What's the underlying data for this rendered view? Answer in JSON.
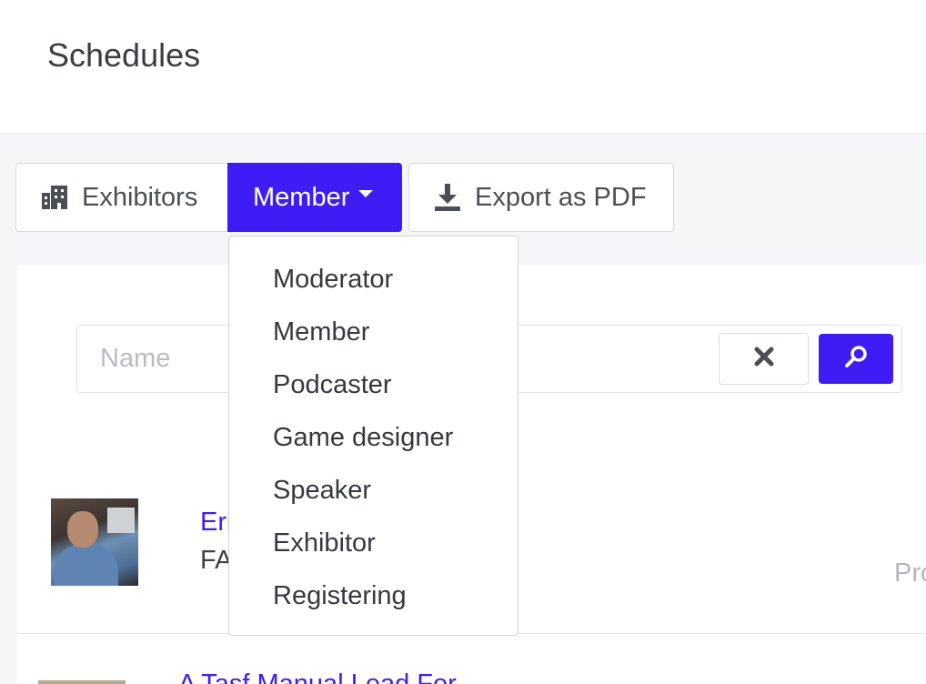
{
  "header": {
    "title": "Schedules"
  },
  "toolbar": {
    "exhibitors_label": "Exhibitors",
    "member_label": "Member",
    "export_label": "Export as PDF"
  },
  "dropdown": {
    "items": [
      {
        "label": "Moderator"
      },
      {
        "label": "Member"
      },
      {
        "label": "Podcaster"
      },
      {
        "label": "Game designer"
      },
      {
        "label": "Speaker"
      },
      {
        "label": "Exhibitor"
      },
      {
        "label": "Registering"
      }
    ]
  },
  "search": {
    "placeholder": "Name",
    "value": ""
  },
  "list": {
    "items": [
      {
        "name": "Eri",
        "subtitle": "FA",
        "right": "Pro"
      },
      {
        "name": "A Tasf Manual Lead For"
      }
    ]
  },
  "colors": {
    "accent": "#3d1cf5",
    "background": "#f5f6f8"
  },
  "icons": {
    "exhibitors": "building-icon",
    "member": "caret-down-icon",
    "export": "download-icon",
    "clear": "close-icon",
    "search": "search-icon"
  }
}
